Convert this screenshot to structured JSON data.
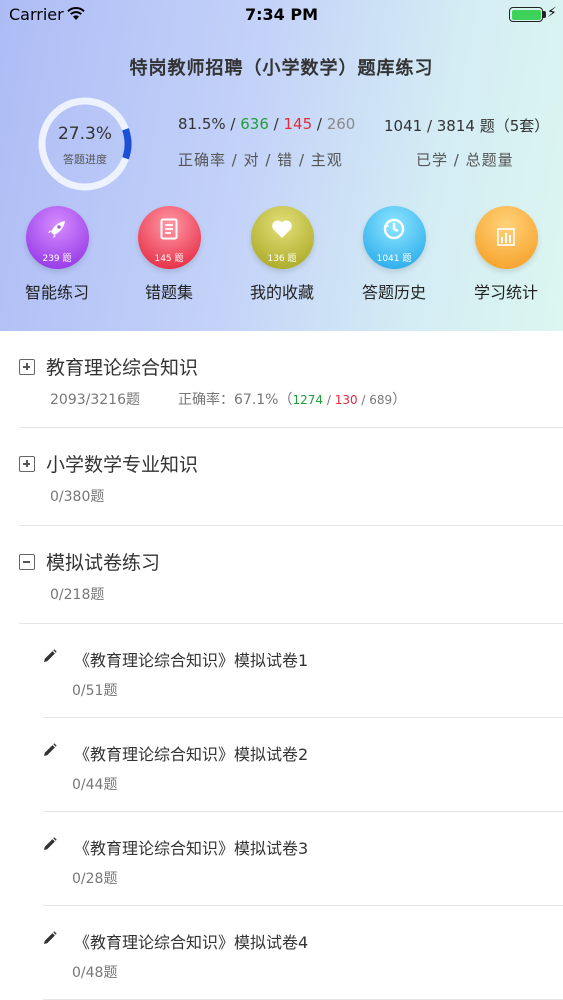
{
  "status_bar": {
    "carrier": "Carrier",
    "time": "7:34 PM"
  },
  "page": {
    "title": "特岗教师招聘（小学数学）题库练习"
  },
  "progress": {
    "percent_text": "27.3%",
    "label": "答题进度",
    "fraction": 0.273,
    "ring_color": "#1a4fd6"
  },
  "stats": {
    "accuracy": "81.5%",
    "correct": "636",
    "wrong": "145",
    "subjective": "260",
    "caption": "正确率 / 对 / 错 / 主观",
    "learned_total": "1041 / 3814 题（5套）",
    "learned_caption": "已学 / 总题量"
  },
  "features": [
    {
      "label": "智能练习",
      "count": "239 题",
      "icon": "rocket-icon",
      "colors": [
        "#d68cff",
        "#8a2be2"
      ]
    },
    {
      "label": "错题集",
      "count": "145 题",
      "icon": "document-icon",
      "colors": [
        "#ff9aa6",
        "#e21b35"
      ]
    },
    {
      "label": "我的收藏",
      "count": "136 题",
      "icon": "heart-icon",
      "colors": [
        "#e3e07a",
        "#a3a21a"
      ]
    },
    {
      "label": "答题历史",
      "count": "1041 题",
      "icon": "history-icon",
      "colors": [
        "#8fe6ff",
        "#1aa3e8"
      ]
    },
    {
      "label": "学习统计",
      "count": "",
      "icon": "bar-chart-icon",
      "colors": [
        "#ffd27a",
        "#f59a1e"
      ]
    }
  ],
  "sections": [
    {
      "title": "教育理论综合知识",
      "progress": "2093/3216题",
      "accuracy_label": "正确率：67.1%（",
      "acc_correct": "1274",
      "acc_wrong": "130",
      "acc_subjective": "689",
      "acc_close": "）",
      "expanded": false
    },
    {
      "title": "小学数学专业知识",
      "progress": "0/380题",
      "expanded": false
    },
    {
      "title": "模拟试卷练习",
      "progress": "0/218题",
      "expanded": true
    }
  ],
  "papers": [
    {
      "title": "《教育理论综合知识》模拟试卷1",
      "count": "0/51题"
    },
    {
      "title": "《教育理论综合知识》模拟试卷2",
      "count": "0/44题"
    },
    {
      "title": "《教育理论综合知识》模拟试卷3",
      "count": "0/28题"
    },
    {
      "title": "《教育理论综合知识》模拟试卷4",
      "count": "0/48题"
    }
  ]
}
